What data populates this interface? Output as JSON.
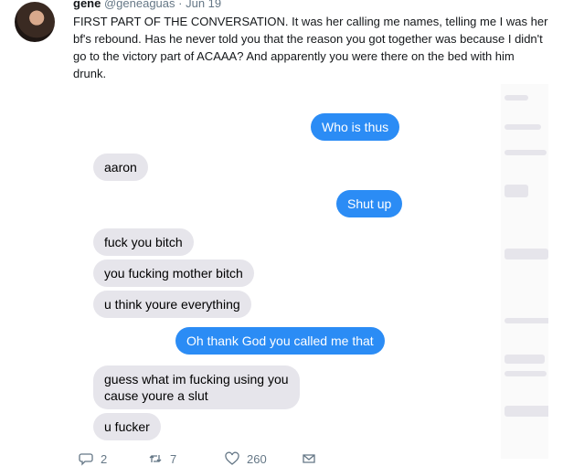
{
  "tweet": {
    "name": "gene",
    "handle": "@geneaguas",
    "dot": "·",
    "date": "Jun 19",
    "text": "FIRST PART OF THE CONVERSATION. It was her calling me names, telling me I was her bf's rebound. Has he never told you that the reason you got together was because I didn't go to the victory part of ACAAA? And apparently you were there on the bed with him drunk."
  },
  "chat": [
    {
      "side": "right",
      "text": "Who is thus"
    },
    {
      "side": "left",
      "text": "aaron"
    },
    {
      "side": "right",
      "text": "Shut up"
    },
    {
      "side": "left",
      "text": "fuck you bitch"
    },
    {
      "side": "left",
      "text": "you fucking mother bitch"
    },
    {
      "side": "left",
      "text": "u think youre everything"
    },
    {
      "side": "right",
      "text": "Oh thank God you called me that"
    },
    {
      "side": "left",
      "text": "guess what im fucking using you\ncause youre a slut"
    },
    {
      "side": "left",
      "text": "u fucker"
    }
  ],
  "actions": {
    "replies": "2",
    "retweets": "7",
    "likes": "260"
  },
  "icons": [
    "reply-icon",
    "retweet-icon",
    "like-icon",
    "message-icon"
  ],
  "colors": {
    "sent_bubble": "#2b8cf5",
    "received_bubble": "#e6e5eb",
    "muted": "#657786"
  }
}
